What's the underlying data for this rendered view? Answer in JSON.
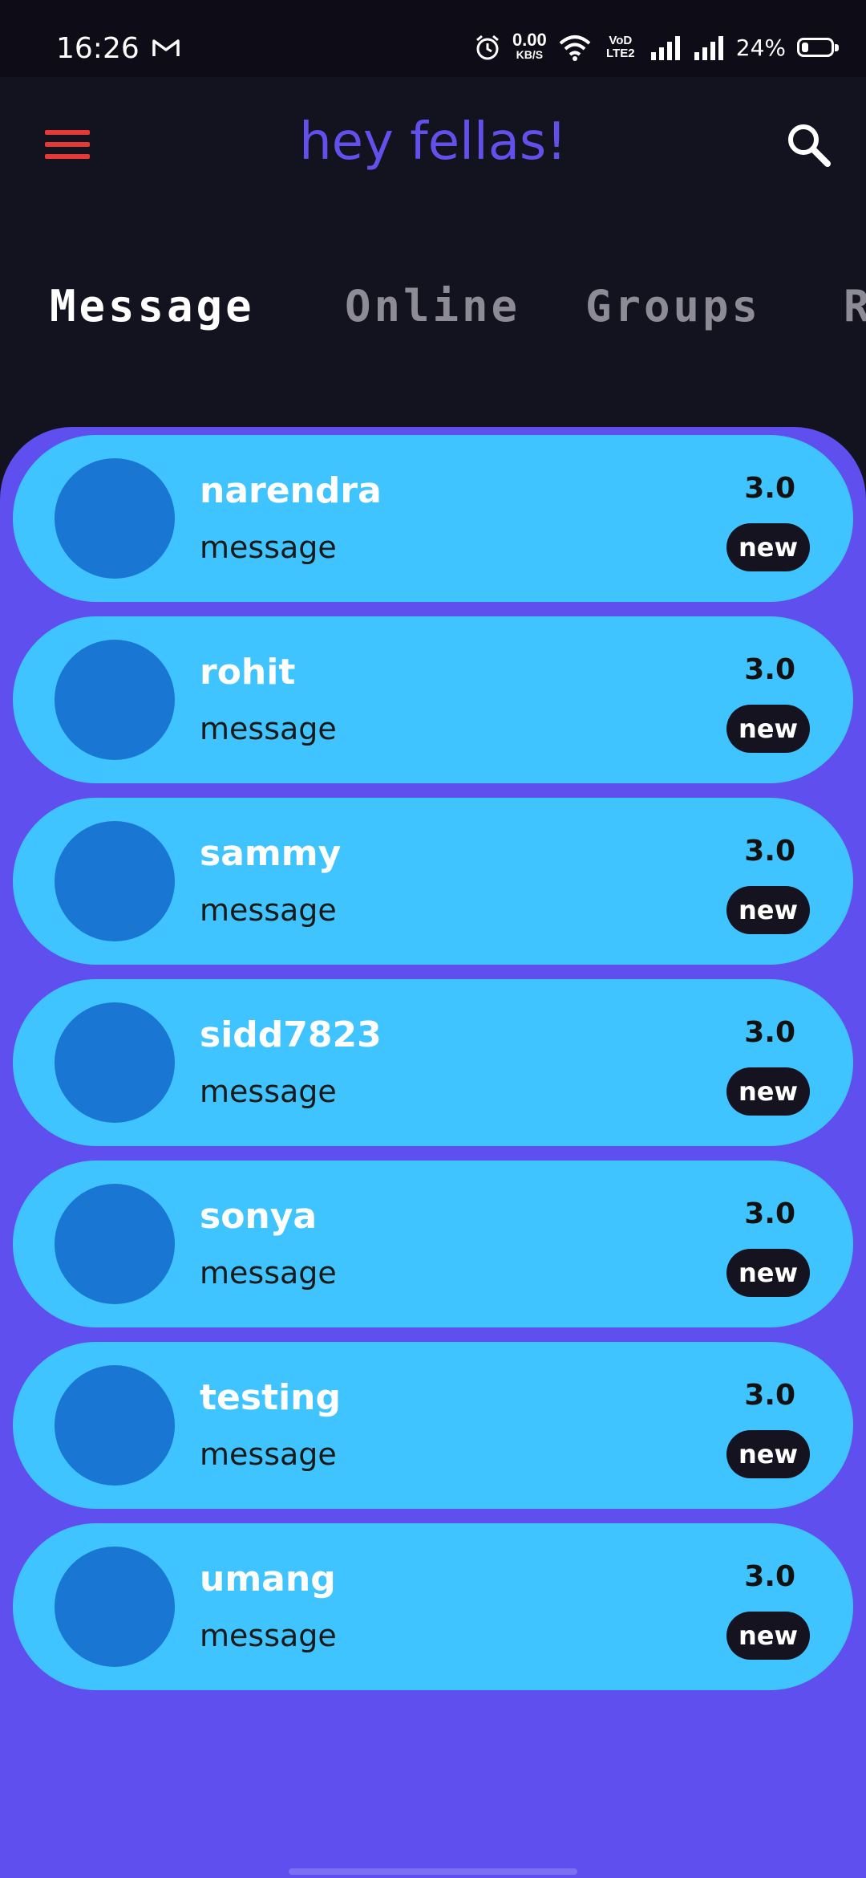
{
  "status_bar": {
    "time": "16:26",
    "net_speed_value": "0.00",
    "net_speed_unit": "KB/S",
    "volte_label": "VoD LTE2",
    "battery_percent": "24%",
    "icons": [
      "gmail-icon",
      "alarm-icon",
      "wifi-icon",
      "signal-icon",
      "battery-icon"
    ]
  },
  "app_bar": {
    "title": "hey fellas!",
    "menu_icon": "hamburger-menu-icon",
    "search_icon": "search-icon",
    "menu_color": "#e53935",
    "title_color": "#6250ea"
  },
  "tabs": [
    {
      "label": "Message",
      "active": true
    },
    {
      "label": "Online",
      "active": false
    },
    {
      "label": "Groups",
      "active": false
    },
    {
      "label": "R",
      "active": false
    }
  ],
  "colors": {
    "background": "#13121f",
    "panel": "#5f4fef",
    "card": "#40c4ff",
    "avatar": "#1976d2",
    "badge": "#14131f"
  },
  "chats": [
    {
      "name": "narendra",
      "message": "message",
      "rating": "3.0",
      "badge": "new"
    },
    {
      "name": "rohit",
      "message": "message",
      "rating": "3.0",
      "badge": "new"
    },
    {
      "name": "sammy",
      "message": "message",
      "rating": "3.0",
      "badge": "new"
    },
    {
      "name": "sidd7823",
      "message": "message",
      "rating": "3.0",
      "badge": "new"
    },
    {
      "name": "sonya",
      "message": "message",
      "rating": "3.0",
      "badge": "new"
    },
    {
      "name": "testing",
      "message": "message",
      "rating": "3.0",
      "badge": "new"
    },
    {
      "name": "umang",
      "message": "message",
      "rating": "3.0",
      "badge": "new"
    }
  ]
}
